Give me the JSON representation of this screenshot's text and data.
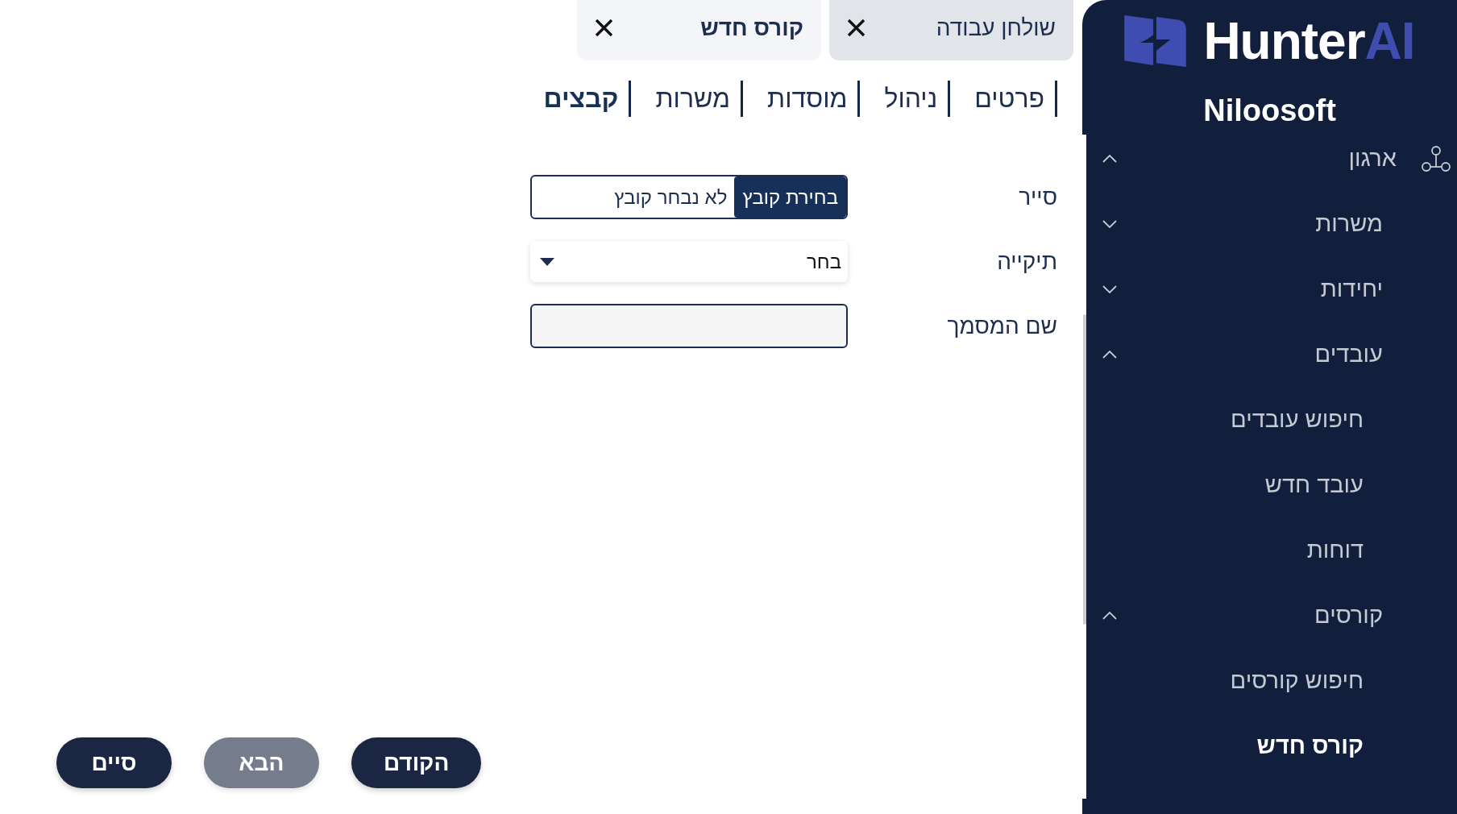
{
  "sidebar": {
    "logo": {
      "text": "Hunter",
      "accent": "AI"
    },
    "organization": "Niloosoft",
    "items": [
      {
        "label": "ארגון",
        "expanded": true,
        "selected": false,
        "children": [
          {
            "label": "משרות",
            "expanded": false,
            "selected": false
          },
          {
            "label": "יחידות",
            "expanded": false,
            "selected": false
          },
          {
            "label": "עובדים",
            "expanded": true,
            "selected": false,
            "children": [
              {
                "label": "חיפוש עובדים",
                "selected": false
              },
              {
                "label": "עובד חדש",
                "selected": false
              },
              {
                "label": "דוחות",
                "selected": false
              }
            ]
          },
          {
            "label": "קורסים",
            "expanded": true,
            "selected": false,
            "children": [
              {
                "label": "חיפוש קורסים",
                "selected": false
              },
              {
                "label": "קורס חדש",
                "selected": true
              }
            ]
          }
        ]
      }
    ]
  },
  "open_tabs": [
    {
      "label": "שולחן עבודה",
      "selected": false
    },
    {
      "label": "קורס חדש",
      "selected": true
    }
  ],
  "section_tabs": [
    {
      "label": "פרטים",
      "selected": false
    },
    {
      "label": "ניהול",
      "selected": false
    },
    {
      "label": "מוסדות",
      "selected": false
    },
    {
      "label": "משרות",
      "selected": false
    },
    {
      "label": "קבצים",
      "selected": true
    }
  ],
  "form": {
    "fields": [
      {
        "kind": "file",
        "label": "סייר",
        "button": "בחירת קובץ",
        "status": "לא נבחר קובץ"
      },
      {
        "kind": "select",
        "label": "תיקייה",
        "value": "בחר"
      },
      {
        "kind": "text",
        "label": "שם המסמך"
      }
    ]
  },
  "buttons": [
    {
      "label": "הקודם",
      "disabled": false
    },
    {
      "label": "הבא",
      "disabled": true
    },
    {
      "label": "סיים",
      "disabled": false
    }
  ]
}
